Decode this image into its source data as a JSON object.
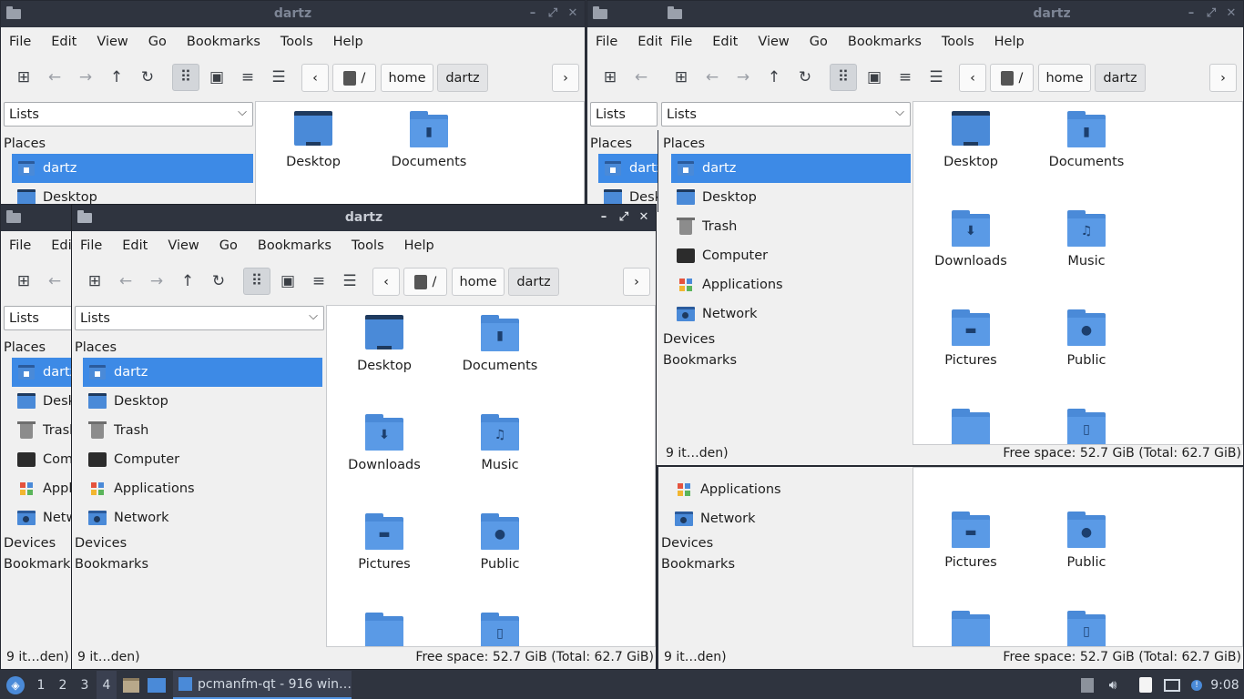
{
  "window_title": "dartz",
  "menu": [
    "File",
    "Edit",
    "View",
    "Go",
    "Bookmarks",
    "Tools",
    "Help"
  ],
  "location": {
    "root": "/",
    "crumbs": [
      "home",
      "dartz"
    ]
  },
  "view_combo": "Lists",
  "sidebar": {
    "places_label": "Places",
    "items": [
      {
        "label": "dartz",
        "icon": "home-folder-icon"
      },
      {
        "label": "Desktop",
        "icon": "desktop-icon"
      },
      {
        "label": "Trash",
        "icon": "trash-icon"
      },
      {
        "label": "Computer",
        "icon": "computer-icon"
      },
      {
        "label": "Applications",
        "icon": "applications-icon"
      },
      {
        "label": "Network",
        "icon": "network-icon"
      }
    ],
    "devices_label": "Devices",
    "bookmarks_label": "Bookmarks"
  },
  "files": [
    {
      "name": "Desktop",
      "icon": "desktop-folder-icon"
    },
    {
      "name": "Documents",
      "icon": "documents-folder-icon"
    },
    {
      "name": "Downloads",
      "icon": "downloads-folder-icon"
    },
    {
      "name": "Music",
      "icon": "music-folder-icon"
    },
    {
      "name": "Pictures",
      "icon": "pictures-folder-icon"
    },
    {
      "name": "Public",
      "icon": "public-folder-icon"
    },
    {
      "name": "",
      "icon": "folder-icon"
    },
    {
      "name": "",
      "icon": "templates-folder-icon"
    }
  ],
  "status": {
    "left": "9 it…den)",
    "right": "Free space: 52.7 GiB (Total: 62.7 GiB)"
  },
  "taskbar": {
    "workspaces": [
      "1",
      "2",
      "3",
      "4"
    ],
    "current_workspace": "4",
    "task_label": "pcmanfm-qt - 916 win…",
    "clock": "9:08"
  },
  "colors": {
    "accent": "#3d8ae6",
    "folder": "#5a9ae6",
    "panel": "#2f343f"
  }
}
